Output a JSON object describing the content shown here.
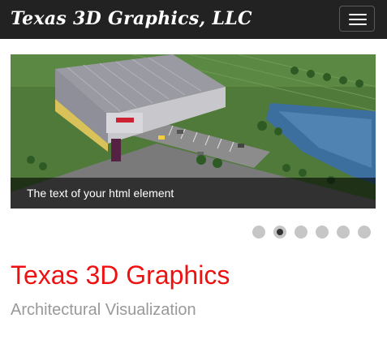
{
  "navbar": {
    "brand": "Texas 3D Graphics, LLC",
    "menu_icon": "hamburger-menu-icon"
  },
  "slider": {
    "caption": "The text of your html element",
    "slide_count": 6,
    "active_index": 1
  },
  "content": {
    "title": "Texas 3D Graphics",
    "subtitle": "Architectural Visualization"
  },
  "colors": {
    "navbar_bg": "#222222",
    "title_red": "#ee1111",
    "subtitle_gray": "#999999",
    "dot_inactive": "#c6c6c6",
    "dot_active_center": "#333333"
  }
}
